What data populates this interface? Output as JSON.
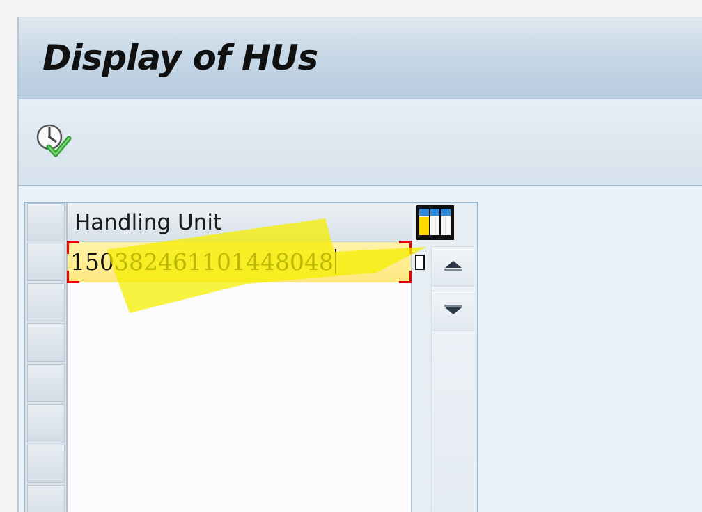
{
  "window": {
    "title": "Display of HUs"
  },
  "toolbar": {
    "execute_icon": "execute-icon"
  },
  "table": {
    "column_header": "Handling Unit",
    "rows": [
      {
        "handling_unit": "150382461101448048"
      },
      {
        "handling_unit": ""
      },
      {
        "handling_unit": ""
      },
      {
        "handling_unit": ""
      },
      {
        "handling_unit": ""
      },
      {
        "handling_unit": ""
      },
      {
        "handling_unit": ""
      }
    ],
    "config_icon": "column-config-icon",
    "scroll_up_icon": "scroll-up-icon",
    "scroll_down_icon": "scroll-down-icon"
  },
  "colors": {
    "highlight": "#ffe87f",
    "selection_corner": "#ee0000",
    "highlighter_annotation": "#f6ef00"
  }
}
